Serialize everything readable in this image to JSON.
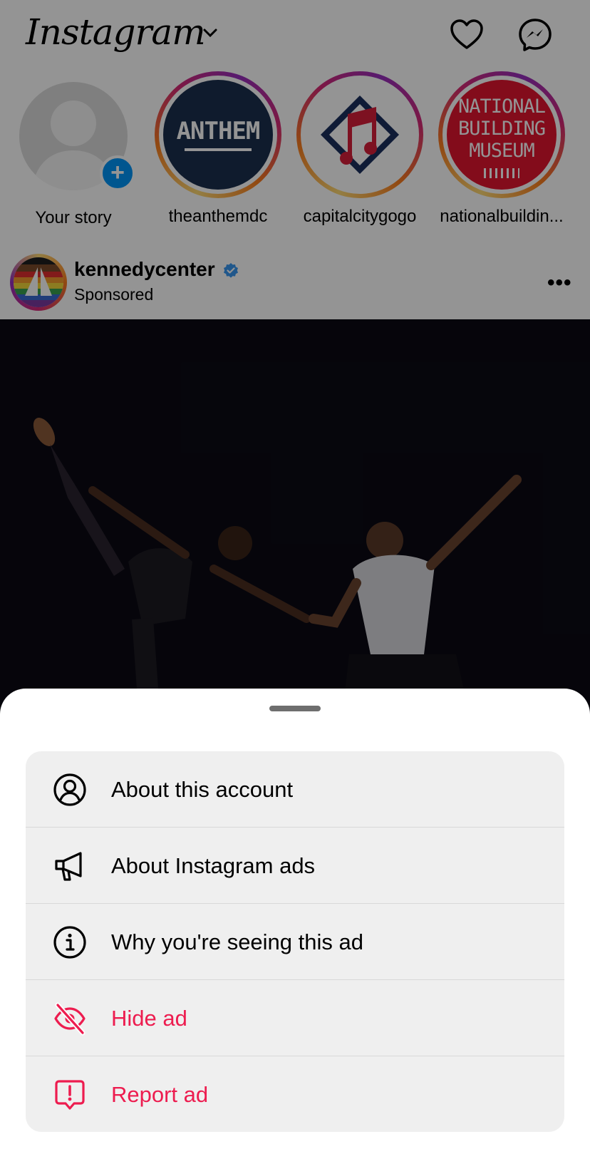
{
  "header": {
    "logo": "Instagram",
    "icons": [
      "heart-icon",
      "messenger-icon"
    ]
  },
  "stories": [
    {
      "name": "Your story",
      "type": "own"
    },
    {
      "name": "theanthemdc",
      "logo_text": "ANTHEM"
    },
    {
      "name": "capitalcitygogo"
    },
    {
      "name": "nationalbuildin...",
      "logo_lines": [
        "NATIONAL",
        "BUILDING",
        "MUSEUM"
      ]
    }
  ],
  "post": {
    "username": "kennedycenter",
    "subtitle": "Sponsored",
    "more": "•••"
  },
  "sheet": {
    "items": [
      {
        "label": "About this account",
        "icon": "user-circle-icon"
      },
      {
        "label": "About Instagram ads",
        "icon": "megaphone-icon"
      },
      {
        "label": "Why you're seeing this ad",
        "icon": "info-icon"
      },
      {
        "label": "Hide ad",
        "icon": "eye-off-icon",
        "color": "#ed1c4f"
      },
      {
        "label": "Report ad",
        "icon": "report-icon",
        "color": "#ed1c4f"
      }
    ]
  },
  "colors": {
    "danger": "#ed1c4f",
    "sheet_bg": "#ffffff",
    "menu_bg": "#efefef",
    "accent": "#0095f6"
  }
}
